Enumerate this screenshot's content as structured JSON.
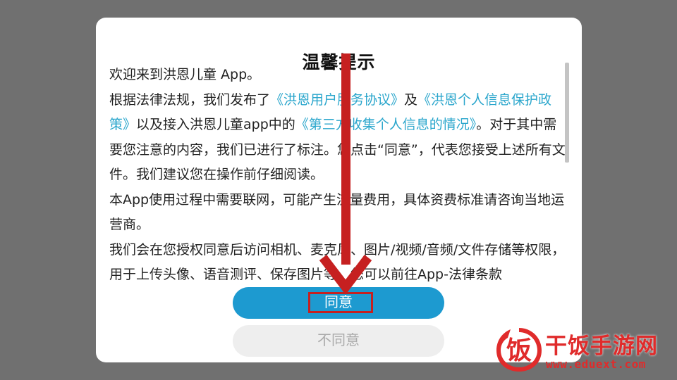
{
  "dialog": {
    "title": "温馨提示",
    "paragraphs": [
      {
        "parts": [
          {
            "text": "欢迎来到洪恩儿童 App。",
            "link": false
          }
        ]
      },
      {
        "parts": [
          {
            "text": "根据法律法规，我们发布了",
            "link": false
          },
          {
            "text": "《洪恩用户服务协议》",
            "link": true
          },
          {
            "text": "及",
            "link": false
          },
          {
            "text": "《洪恩个人信息保护政策》",
            "link": true
          },
          {
            "text": "以及接入洪恩儿童app中的",
            "link": false
          },
          {
            "text": "《第三方收集个人信息的情况》",
            "link": true
          },
          {
            "text": "。对于其中需要您注意的内容，我们已进行了标注。您点击“同意”，代表您接受上述所有文件。我们建议您在操作前仔细阅读。",
            "link": false
          }
        ]
      },
      {
        "parts": [
          {
            "text": "本App使用过程中需要联网，可能产生流量费用，具体资费标准请咨询当地运营商。",
            "link": false
          }
        ]
      },
      {
        "parts": [
          {
            "text": "我们会在您授权同意后访问相机、麦克风、图片/视频/音频/文件存储等权限，用于上传头像、语音测评、保存图片等，您可以前往App-法律条款",
            "link": false
          }
        ]
      }
    ],
    "agree_label": "同意",
    "disagree_label": "不同意"
  },
  "watermark": {
    "logo_char": "饭",
    "name": "干饭手游网",
    "url": "www.eduext.com"
  },
  "colors": {
    "backdrop": "#707070",
    "link": "#2aa6cc",
    "agree_button": "#1d9ad0",
    "annotation": "#c62020",
    "watermark": "#e02b2b"
  }
}
